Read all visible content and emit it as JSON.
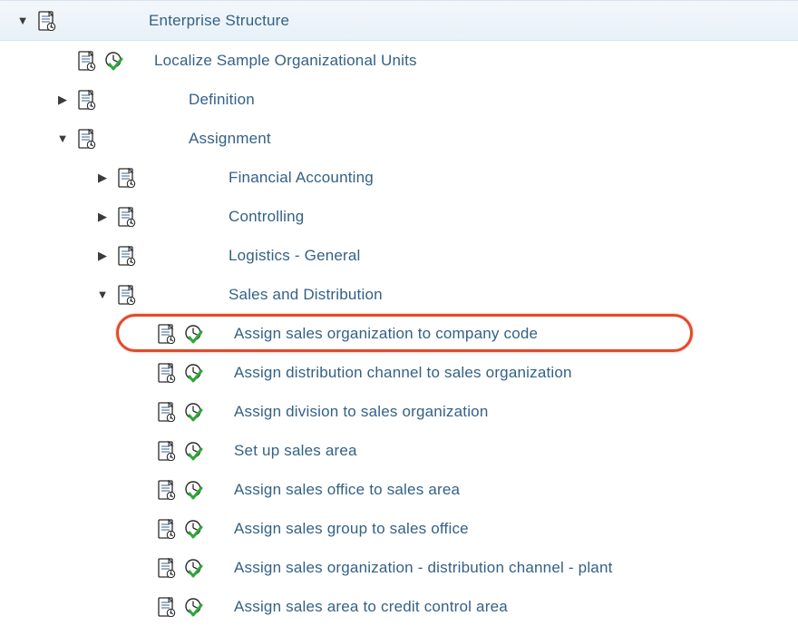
{
  "tree": {
    "root": {
      "label": "Enterprise Structure",
      "expanded": true,
      "children": [
        {
          "label": "Localize Sample Organizational Units",
          "hasClock": true
        },
        {
          "label": "Definition",
          "expandable": true,
          "expanded": false
        },
        {
          "label": "Assignment",
          "expandable": true,
          "expanded": true,
          "children": [
            {
              "label": "Financial Accounting",
              "expandable": true,
              "expanded": false
            },
            {
              "label": "Controlling",
              "expandable": true,
              "expanded": false
            },
            {
              "label": "Logistics - General",
              "expandable": true,
              "expanded": false
            },
            {
              "label": "Sales and Distribution",
              "expandable": true,
              "expanded": true,
              "children": [
                {
                  "label": "Assign sales organization to company code",
                  "hasClock": true,
                  "highlighted": true
                },
                {
                  "label": "Assign distribution channel to sales organization",
                  "hasClock": true
                },
                {
                  "label": "Assign division to sales organization",
                  "hasClock": true
                },
                {
                  "label": "Set up sales area",
                  "hasClock": true
                },
                {
                  "label": "Assign sales office to sales area",
                  "hasClock": true
                },
                {
                  "label": "Assign sales group to sales office",
                  "hasClock": true
                },
                {
                  "label": "Assign sales organization - distribution channel - plant",
                  "hasClock": true
                },
                {
                  "label": "Assign sales area to credit control area",
                  "hasClock": true
                }
              ]
            }
          ]
        }
      ]
    }
  },
  "glyphs": {
    "expanded": "▼",
    "collapsed": "▶"
  }
}
